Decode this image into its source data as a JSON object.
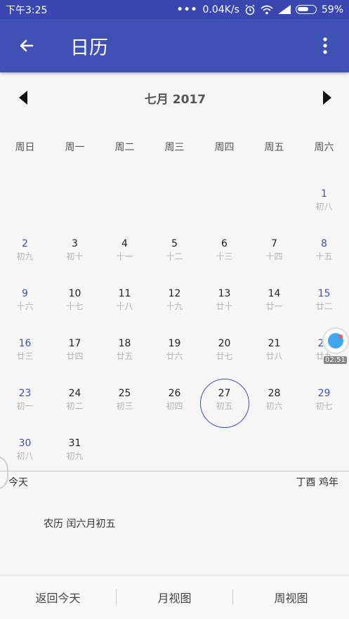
{
  "status_bar": {
    "time": "下午3:25",
    "dots": "•••",
    "speed": "0.04K/s",
    "battery": "59%"
  },
  "app_bar": {
    "title": "日历"
  },
  "month_nav": {
    "title": "七月 2017"
  },
  "weekdays": [
    "周日",
    "周一",
    "周二",
    "周三",
    "周四",
    "周五",
    "周六"
  ],
  "days": [
    {
      "day": "1",
      "lunar": "初八"
    },
    {
      "day": "2",
      "lunar": "初九"
    },
    {
      "day": "3",
      "lunar": "初十"
    },
    {
      "day": "4",
      "lunar": "十一"
    },
    {
      "day": "5",
      "lunar": "十二"
    },
    {
      "day": "6",
      "lunar": "十三"
    },
    {
      "day": "7",
      "lunar": "十四"
    },
    {
      "day": "8",
      "lunar": "十五"
    },
    {
      "day": "9",
      "lunar": "十六"
    },
    {
      "day": "10",
      "lunar": "十七"
    },
    {
      "day": "11",
      "lunar": "十八"
    },
    {
      "day": "12",
      "lunar": "十九"
    },
    {
      "day": "13",
      "lunar": "廿十"
    },
    {
      "day": "14",
      "lunar": "廿一"
    },
    {
      "day": "15",
      "lunar": "廿二"
    },
    {
      "day": "16",
      "lunar": "廿三"
    },
    {
      "day": "17",
      "lunar": "廿四"
    },
    {
      "day": "18",
      "lunar": "廿五"
    },
    {
      "day": "19",
      "lunar": "廿六"
    },
    {
      "day": "20",
      "lunar": "廿七"
    },
    {
      "day": "21",
      "lunar": "廿八"
    },
    {
      "day": "22",
      "lunar": "廿九"
    },
    {
      "day": "23",
      "lunar": "初一"
    },
    {
      "day": "24",
      "lunar": "初二"
    },
    {
      "day": "25",
      "lunar": "初三"
    },
    {
      "day": "26",
      "lunar": "初四"
    },
    {
      "day": "27",
      "lunar": "初五"
    },
    {
      "day": "28",
      "lunar": "初六"
    },
    {
      "day": "29",
      "lunar": "初七"
    },
    {
      "day": "30",
      "lunar": "初八"
    },
    {
      "day": "31",
      "lunar": "初九"
    }
  ],
  "info": {
    "today_label": "今天",
    "year_label": "丁酉 鸡年",
    "lunar_date": "农历 闰六月初五"
  },
  "bottom_bar": {
    "back_today": "返回今天",
    "month_view": "月视图",
    "week_view": "周视图"
  },
  "float_widget": {
    "label": "02:51"
  },
  "colors": {
    "primary": "#3f51b5",
    "status_bar": "#3a47b0",
    "weekend_text": "#3f51b5",
    "lunar_text": "#b4b4b4"
  }
}
